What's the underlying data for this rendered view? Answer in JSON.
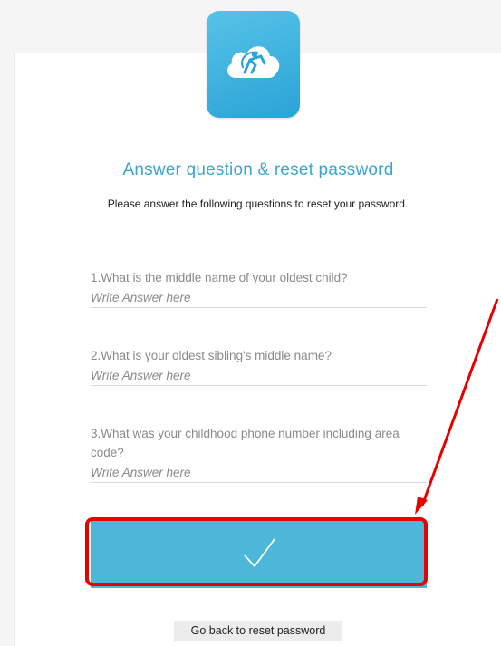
{
  "header": {
    "title": "Answer question & reset password",
    "subtitle": "Please answer the following questions to reset your password."
  },
  "questions": [
    {
      "label": "1.What is the middle name of your oldest child?",
      "placeholder": "Write Answer here"
    },
    {
      "label": "2.What is your oldest sibling's middle name?",
      "placeholder": "Write Answer here"
    },
    {
      "label": "3.What was your childhood phone number including area code?",
      "placeholder": "Write Answer here"
    }
  ],
  "icons": {
    "logo": "cloud-logo-icon",
    "submit": "checkmark-icon"
  },
  "links": {
    "back_label": "Go back to reset password"
  },
  "colors": {
    "accent": "#3aa6cf",
    "button": "#4db7d9",
    "annotation": "#e60000"
  }
}
